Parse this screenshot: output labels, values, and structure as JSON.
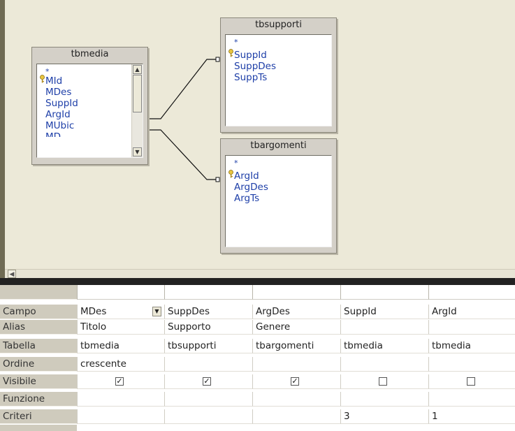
{
  "tables": [
    {
      "id": "tbmedia",
      "title": "tbmedia",
      "fields": [
        "*",
        "MId",
        "MDes",
        "SuppId",
        "ArgId",
        "MUbic",
        "MD..."
      ]
    },
    {
      "id": "tbsupporti",
      "title": "tbsupporti",
      "fields": [
        "*",
        "SuppId",
        "SuppDes",
        "SuppTs"
      ]
    },
    {
      "id": "tbargomenti",
      "title": "tbargomenti",
      "fields": [
        "*",
        "ArgId",
        "ArgDes",
        "ArgTs"
      ]
    }
  ],
  "grid": {
    "row_labels": [
      "Campo",
      "Alias",
      "Tabella",
      "Ordine",
      "Visibile",
      "Funzione",
      "Criteri"
    ],
    "columns": [
      {
        "campo": "MDes",
        "alias": "Titolo",
        "tabella": "tbmedia",
        "ordine": "crescente",
        "visibile": true,
        "funzione": "",
        "criteri": ""
      },
      {
        "campo": "SuppDes",
        "alias": "Supporto",
        "tabella": "tbsupporti",
        "ordine": "",
        "visibile": true,
        "funzione": "",
        "criteri": ""
      },
      {
        "campo": "ArgDes",
        "alias": "Genere",
        "tabella": "tbargomenti",
        "ordine": "",
        "visibile": true,
        "funzione": "",
        "criteri": ""
      },
      {
        "campo": "SuppId",
        "alias": "",
        "tabella": "tbmedia",
        "ordine": "",
        "visibile": false,
        "funzione": "",
        "criteri": "3"
      },
      {
        "campo": "ArgId",
        "alias": "",
        "tabella": "tbmedia",
        "ordine": "",
        "visibile": false,
        "funzione": "",
        "criteri": "1"
      }
    ]
  },
  "icons": {
    "primary_key": "key-icon",
    "dropdown": "chevron-down-icon",
    "scroll_left": "arrow-left-icon"
  },
  "colors": {
    "design_bg": "#ece9d8",
    "field_text": "#1e3fa8",
    "row_label_bg": "#cfcbbd",
    "divider": "#222222"
  }
}
